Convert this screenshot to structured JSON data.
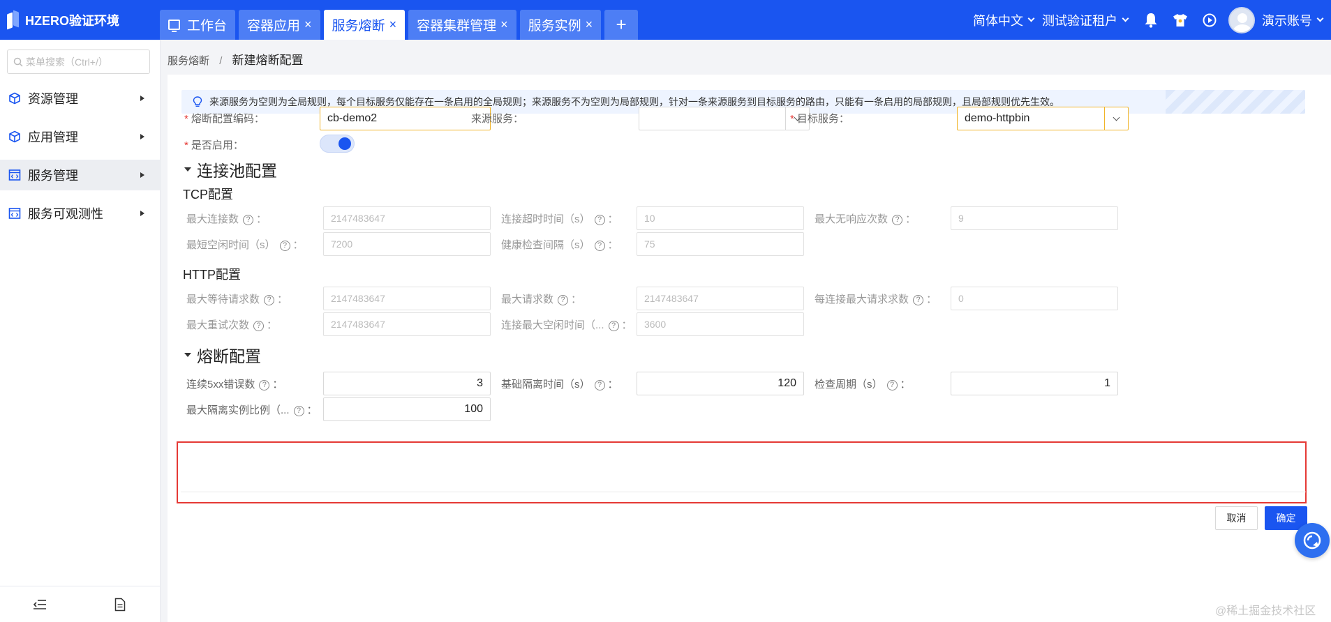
{
  "app": {
    "title": "HZERO验证环境"
  },
  "tabs": [
    {
      "label": "工作台",
      "closable": false,
      "active": false
    },
    {
      "label": "容器应用",
      "closable": true,
      "active": false
    },
    {
      "label": "服务熔断",
      "closable": true,
      "active": true
    },
    {
      "label": "容器集群管理",
      "closable": true,
      "active": false
    },
    {
      "label": "服务实例",
      "closable": true,
      "active": false
    }
  ],
  "tab_close_glyph": "×",
  "tab_add_glyph": "+",
  "header": {
    "language": "简体中文",
    "tenant": "测试验证租户",
    "account": "演示账号"
  },
  "sidebar": {
    "search_placeholder": "菜单搜索（Ctrl+/）",
    "items": [
      {
        "label": "资源管理",
        "icon": "cube-icon",
        "active": false
      },
      {
        "label": "应用管理",
        "icon": "cube-icon",
        "active": false
      },
      {
        "label": "服务管理",
        "icon": "code-window-icon",
        "active": true
      },
      {
        "label": "服务可观测性",
        "icon": "code-window-icon",
        "active": false
      }
    ]
  },
  "breadcrumb": {
    "parent": "服务熔断",
    "separator": "/",
    "current": "新建熔断配置"
  },
  "notice": "来源服务为空则为全局规则，每个目标服务仅能存在一条启用的全局规则；来源服务不为空则为局部规则，针对一条来源服务到目标服务的路由，只能有一条启用的局部规则，且局部规则优先生效。",
  "form": {
    "code": {
      "label": "熔断配置编码：",
      "value": "cb-demo2"
    },
    "source": {
      "label": "来源服务：",
      "value": ""
    },
    "target": {
      "label": "目标服务：",
      "value": "demo-httpbin"
    },
    "enabled": {
      "label": "是否启用：",
      "value": true
    }
  },
  "pool": {
    "title": "连接池配置",
    "tcp": {
      "title": "TCP配置",
      "max_connections": {
        "label": "最大连接数",
        "value": "2147483647"
      },
      "connect_timeout": {
        "label": "连接超时时间（s）",
        "value": "10"
      },
      "max_no_response": {
        "label": "最大无响应次数",
        "value": "9"
      },
      "min_idle_time": {
        "label": "最短空闲时间（s）",
        "value": "7200"
      },
      "health_interval": {
        "label": "健康检查间隔（s）",
        "value": "75"
      }
    },
    "http": {
      "title": "HTTP配置",
      "max_pending": {
        "label": "最大等待请求数",
        "value": "2147483647"
      },
      "max_requests": {
        "label": "最大请求数",
        "value": "2147483647"
      },
      "max_per_conn": {
        "label": "每连接最大请求求数",
        "value": "0"
      },
      "max_retries": {
        "label": "最大重试次数",
        "value": "2147483647"
      },
      "max_idle": {
        "label": "连接最大空闲时间（...",
        "value": "3600"
      }
    }
  },
  "breaker": {
    "title": "熔断配置",
    "consecutive_5xx": {
      "label": "连续5xx错误数",
      "value": "3"
    },
    "base_ejection": {
      "label": "基础隔离时间（s）",
      "value": "120"
    },
    "interval": {
      "label": "检查周期（s）",
      "value": "1"
    },
    "max_ejection": {
      "label": "最大隔离实例比例（...",
      "value": "100"
    }
  },
  "colon": "：",
  "help_glyph": "?",
  "buttons": {
    "cancel": "取消",
    "ok": "确定"
  },
  "watermark": "@稀土掘金技术社区",
  "colors": {
    "brand": "#1a55f0",
    "tab_inactive": "#4d7ef5",
    "required": "#e53935",
    "focus_border": "#f0b429",
    "highlight_box": "#e53935"
  }
}
